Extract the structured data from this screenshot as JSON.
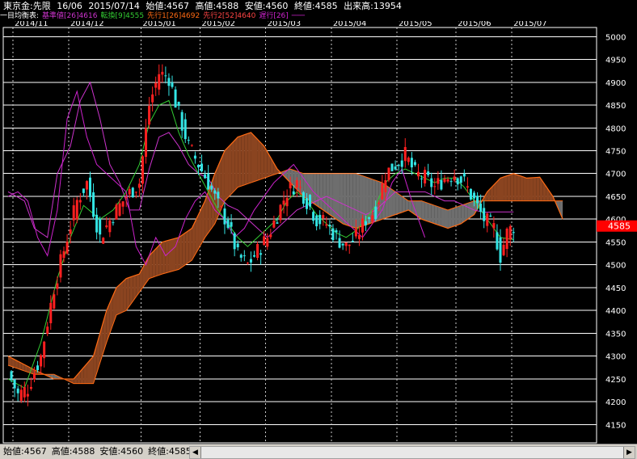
{
  "header": {
    "symbol": "東京金:先限",
    "contract": "16/06",
    "date": "2015/07/14",
    "open": "始値:4567",
    "high": "高値:4588",
    "low": "安値:4560",
    "close": "終値:4585",
    "volume": "出来高:13954"
  },
  "legend": {
    "title": "一目均衡表:",
    "kijun": "基準値[26]4616",
    "tenkan": "転換[9]4555",
    "senkou1": "先行1[26]4692",
    "senkou2": "先行2[52]4640",
    "chikou": "遅行[26]",
    "colors": {
      "kijun": "#cc33cc",
      "tenkan": "#33cc33",
      "senkou1": "#ff6a13",
      "senkou2": "#ff4444",
      "chikou": "#cc22cc",
      "title": "#ffffff"
    }
  },
  "bottom": {
    "open": "始値:4567",
    "high": "高値:4588",
    "low": "安値:4560",
    "close": "終値:4585"
  },
  "icons": {
    "left": "arrow-left-icon",
    "right": "arrow-right-icon"
  },
  "chart_data": {
    "type": "candlestick",
    "title": "東京金:先限",
    "ylim": [
      4110,
      5020
    ],
    "yticks": [
      5000,
      4950,
      4900,
      4850,
      4800,
      4750,
      4700,
      4650,
      4600,
      4550,
      4500,
      4450,
      4400,
      4350,
      4300,
      4250,
      4200,
      4150
    ],
    "xtick_labels": [
      "2014/11",
      "2014/12",
      "2015/01",
      "2015/02",
      "2015/03",
      "2015/04",
      "2015/05",
      "2015/06",
      "2015/07"
    ],
    "xtick_index": [
      0,
      17,
      39,
      57,
      77,
      97,
      117,
      135,
      152
    ],
    "grid": true,
    "last_price": "4585",
    "colors": {
      "up": "#ff2020",
      "down": "#33e5e5",
      "kijun": "#cc33cc",
      "tenkan": "#33cc33",
      "senkou1": "#ff6a13",
      "senkou2": "#ff6a13",
      "chikou": "#cc22cc",
      "cloud_bull": "#8a4420",
      "cloud_bear": "#6e6e6e",
      "grid": "#ffffff",
      "price_box": "#ff0000"
    },
    "close_anchors": [
      [
        0,
        4265
      ],
      [
        3,
        4215
      ],
      [
        6,
        4230
      ],
      [
        10,
        4300
      ],
      [
        14,
        4450
      ],
      [
        18,
        4560
      ],
      [
        21,
        4640
      ],
      [
        24,
        4680
      ],
      [
        28,
        4560
      ],
      [
        32,
        4610
      ],
      [
        36,
        4650
      ],
      [
        40,
        4680
      ],
      [
        43,
        4850
      ],
      [
        46,
        4920
      ],
      [
        49,
        4910
      ],
      [
        52,
        4830
      ],
      [
        55,
        4760
      ],
      [
        58,
        4720
      ],
      [
        61,
        4680
      ],
      [
        64,
        4630
      ],
      [
        67,
        4590
      ],
      [
        70,
        4520
      ],
      [
        73,
        4500
      ],
      [
        76,
        4530
      ],
      [
        79,
        4560
      ],
      [
        82,
        4610
      ],
      [
        85,
        4660
      ],
      [
        88,
        4680
      ],
      [
        91,
        4640
      ],
      [
        94,
        4600
      ],
      [
        97,
        4590
      ],
      [
        100,
        4560
      ],
      [
        103,
        4540
      ],
      [
        106,
        4560
      ],
      [
        109,
        4600
      ],
      [
        112,
        4620
      ],
      [
        115,
        4700
      ],
      [
        118,
        4720
      ],
      [
        121,
        4740
      ],
      [
        124,
        4700
      ],
      [
        127,
        4690
      ],
      [
        130,
        4670
      ],
      [
        133,
        4690
      ],
      [
        136,
        4700
      ],
      [
        139,
        4680
      ],
      [
        142,
        4640
      ],
      [
        145,
        4600
      ],
      [
        148,
        4580
      ],
      [
        150,
        4520
      ],
      [
        152,
        4570
      ],
      [
        154,
        4585
      ]
    ],
    "kijun_anchors": [
      [
        0,
        4660
      ],
      [
        5,
        4640
      ],
      [
        8,
        4580
      ],
      [
        12,
        4560
      ],
      [
        15,
        4700
      ],
      [
        19,
        4760
      ],
      [
        22,
        4860
      ],
      [
        25,
        4900
      ],
      [
        28,
        4820
      ],
      [
        31,
        4720
      ],
      [
        34,
        4680
      ],
      [
        37,
        4620
      ],
      [
        40,
        4620
      ],
      [
        43,
        4710
      ],
      [
        46,
        4780
      ],
      [
        49,
        4790
      ],
      [
        52,
        4760
      ],
      [
        55,
        4720
      ],
      [
        58,
        4700
      ],
      [
        61,
        4690
      ],
      [
        64,
        4650
      ],
      [
        67,
        4630
      ],
      [
        70,
        4620
      ],
      [
        73,
        4600
      ],
      [
        76,
        4580
      ],
      [
        79,
        4560
      ],
      [
        82,
        4580
      ],
      [
        85,
        4600
      ],
      [
        88,
        4620
      ],
      [
        91,
        4630
      ],
      [
        94,
        4640
      ],
      [
        97,
        4650
      ],
      [
        100,
        4640
      ],
      [
        103,
        4630
      ],
      [
        106,
        4620
      ],
      [
        109,
        4610
      ],
      [
        112,
        4620
      ],
      [
        115,
        4640
      ],
      [
        118,
        4660
      ],
      [
        121,
        4660
      ],
      [
        124,
        4660
      ],
      [
        127,
        4660
      ],
      [
        130,
        4650
      ],
      [
        133,
        4640
      ],
      [
        136,
        4640
      ],
      [
        139,
        4630
      ],
      [
        142,
        4620
      ],
      [
        145,
        4615
      ],
      [
        148,
        4616
      ],
      [
        150,
        4616
      ],
      [
        154,
        4616
      ]
    ],
    "tenkan_anchors": [
      [
        0,
        4250
      ],
      [
        5,
        4230
      ],
      [
        10,
        4330
      ],
      [
        15,
        4470
      ],
      [
        19,
        4560
      ],
      [
        23,
        4630
      ],
      [
        28,
        4600
      ],
      [
        32,
        4620
      ],
      [
        36,
        4660
      ],
      [
        40,
        4720
      ],
      [
        43,
        4810
      ],
      [
        46,
        4850
      ],
      [
        49,
        4860
      ],
      [
        52,
        4790
      ],
      [
        55,
        4740
      ],
      [
        58,
        4700
      ],
      [
        61,
        4660
      ],
      [
        64,
        4620
      ],
      [
        67,
        4590
      ],
      [
        70,
        4560
      ],
      [
        73,
        4540
      ],
      [
        76,
        4560
      ],
      [
        79,
        4580
      ],
      [
        82,
        4600
      ],
      [
        85,
        4640
      ],
      [
        88,
        4660
      ],
      [
        91,
        4640
      ],
      [
        94,
        4610
      ],
      [
        97,
        4590
      ],
      [
        100,
        4570
      ],
      [
        103,
        4560
      ],
      [
        106,
        4575
      ],
      [
        109,
        4600
      ],
      [
        112,
        4630
      ],
      [
        115,
        4680
      ],
      [
        118,
        4700
      ],
      [
        121,
        4710
      ],
      [
        124,
        4700
      ],
      [
        127,
        4690
      ],
      [
        130,
        4680
      ],
      [
        133,
        4690
      ],
      [
        136,
        4690
      ],
      [
        139,
        4670
      ],
      [
        142,
        4640
      ],
      [
        145,
        4610
      ],
      [
        148,
        4580
      ],
      [
        150,
        4560
      ],
      [
        154,
        4555
      ]
    ],
    "senkou1_anchors": [
      [
        0,
        4300
      ],
      [
        8,
        4270
      ],
      [
        14,
        4250
      ],
      [
        20,
        4250
      ],
      [
        26,
        4300
      ],
      [
        30,
        4400
      ],
      [
        33,
        4450
      ],
      [
        36,
        4470
      ],
      [
        40,
        4480
      ],
      [
        43,
        4520
      ],
      [
        47,
        4550
      ],
      [
        52,
        4560
      ],
      [
        56,
        4580
      ],
      [
        60,
        4640
      ],
      [
        63,
        4700
      ],
      [
        66,
        4750
      ],
      [
        70,
        4780
      ],
      [
        74,
        4790
      ],
      [
        78,
        4760
      ],
      [
        82,
        4710
      ],
      [
        86,
        4680
      ],
      [
        90,
        4650
      ],
      [
        94,
        4630
      ],
      [
        98,
        4610
      ],
      [
        102,
        4590
      ],
      [
        106,
        4580
      ],
      [
        110,
        4590
      ],
      [
        114,
        4600
      ],
      [
        118,
        4610
      ],
      [
        122,
        4620
      ],
      [
        126,
        4600
      ],
      [
        130,
        4590
      ],
      [
        134,
        4580
      ],
      [
        138,
        4590
      ],
      [
        142,
        4610
      ],
      [
        146,
        4660
      ],
      [
        150,
        4690
      ],
      [
        154,
        4700
      ],
      [
        158,
        4690
      ],
      [
        162,
        4692
      ],
      [
        166,
        4650
      ],
      [
        169,
        4600
      ]
    ],
    "senkou2_anchors": [
      [
        0,
        4280
      ],
      [
        8,
        4260
      ],
      [
        14,
        4260
      ],
      [
        20,
        4240
      ],
      [
        26,
        4240
      ],
      [
        30,
        4330
      ],
      [
        33,
        4390
      ],
      [
        36,
        4400
      ],
      [
        40,
        4440
      ],
      [
        43,
        4470
      ],
      [
        47,
        4480
      ],
      [
        52,
        4490
      ],
      [
        56,
        4510
      ],
      [
        60,
        4560
      ],
      [
        63,
        4590
      ],
      [
        66,
        4640
      ],
      [
        70,
        4670
      ],
      [
        74,
        4680
      ],
      [
        78,
        4690
      ],
      [
        82,
        4700
      ],
      [
        86,
        4710
      ],
      [
        90,
        4700
      ],
      [
        94,
        4700
      ],
      [
        98,
        4700
      ],
      [
        102,
        4700
      ],
      [
        106,
        4700
      ],
      [
        110,
        4690
      ],
      [
        114,
        4680
      ],
      [
        118,
        4660
      ],
      [
        122,
        4640
      ],
      [
        126,
        4640
      ],
      [
        130,
        4630
      ],
      [
        134,
        4620
      ],
      [
        138,
        4630
      ],
      [
        142,
        4640
      ],
      [
        146,
        4640
      ],
      [
        150,
        4640
      ],
      [
        154,
        4640
      ],
      [
        158,
        4640
      ],
      [
        162,
        4640
      ],
      [
        166,
        4640
      ],
      [
        169,
        4640
      ]
    ],
    "chikou_anchors": [
      [
        0,
        4650
      ],
      [
        3,
        4660
      ],
      [
        6,
        4640
      ],
      [
        9,
        4560
      ],
      [
        12,
        4520
      ],
      [
        15,
        4620
      ],
      [
        18,
        4820
      ],
      [
        21,
        4880
      ],
      [
        24,
        4780
      ],
      [
        27,
        4720
      ],
      [
        30,
        4700
      ],
      [
        33,
        4680
      ],
      [
        36,
        4660
      ],
      [
        39,
        4540
      ],
      [
        42,
        4500
      ],
      [
        45,
        4560
      ],
      [
        48,
        4520
      ],
      [
        51,
        4540
      ],
      [
        54,
        4600
      ],
      [
        57,
        4640
      ],
      [
        60,
        4660
      ],
      [
        63,
        4620
      ],
      [
        66,
        4600
      ],
      [
        69,
        4560
      ],
      [
        72,
        4580
      ],
      [
        75,
        4620
      ],
      [
        78,
        4650
      ],
      [
        81,
        4680
      ],
      [
        84,
        4700
      ],
      [
        87,
        4720
      ],
      [
        90,
        4690
      ],
      [
        93,
        4660
      ],
      [
        96,
        4640
      ],
      [
        99,
        4620
      ],
      [
        102,
        4600
      ],
      [
        105,
        4580
      ],
      [
        108,
        4560
      ],
      [
        111,
        4590
      ],
      [
        114,
        4620
      ],
      [
        117,
        4680
      ],
      [
        120,
        4710
      ],
      [
        123,
        4640
      ],
      [
        126,
        4580
      ],
      [
        127,
        4560
      ]
    ]
  }
}
